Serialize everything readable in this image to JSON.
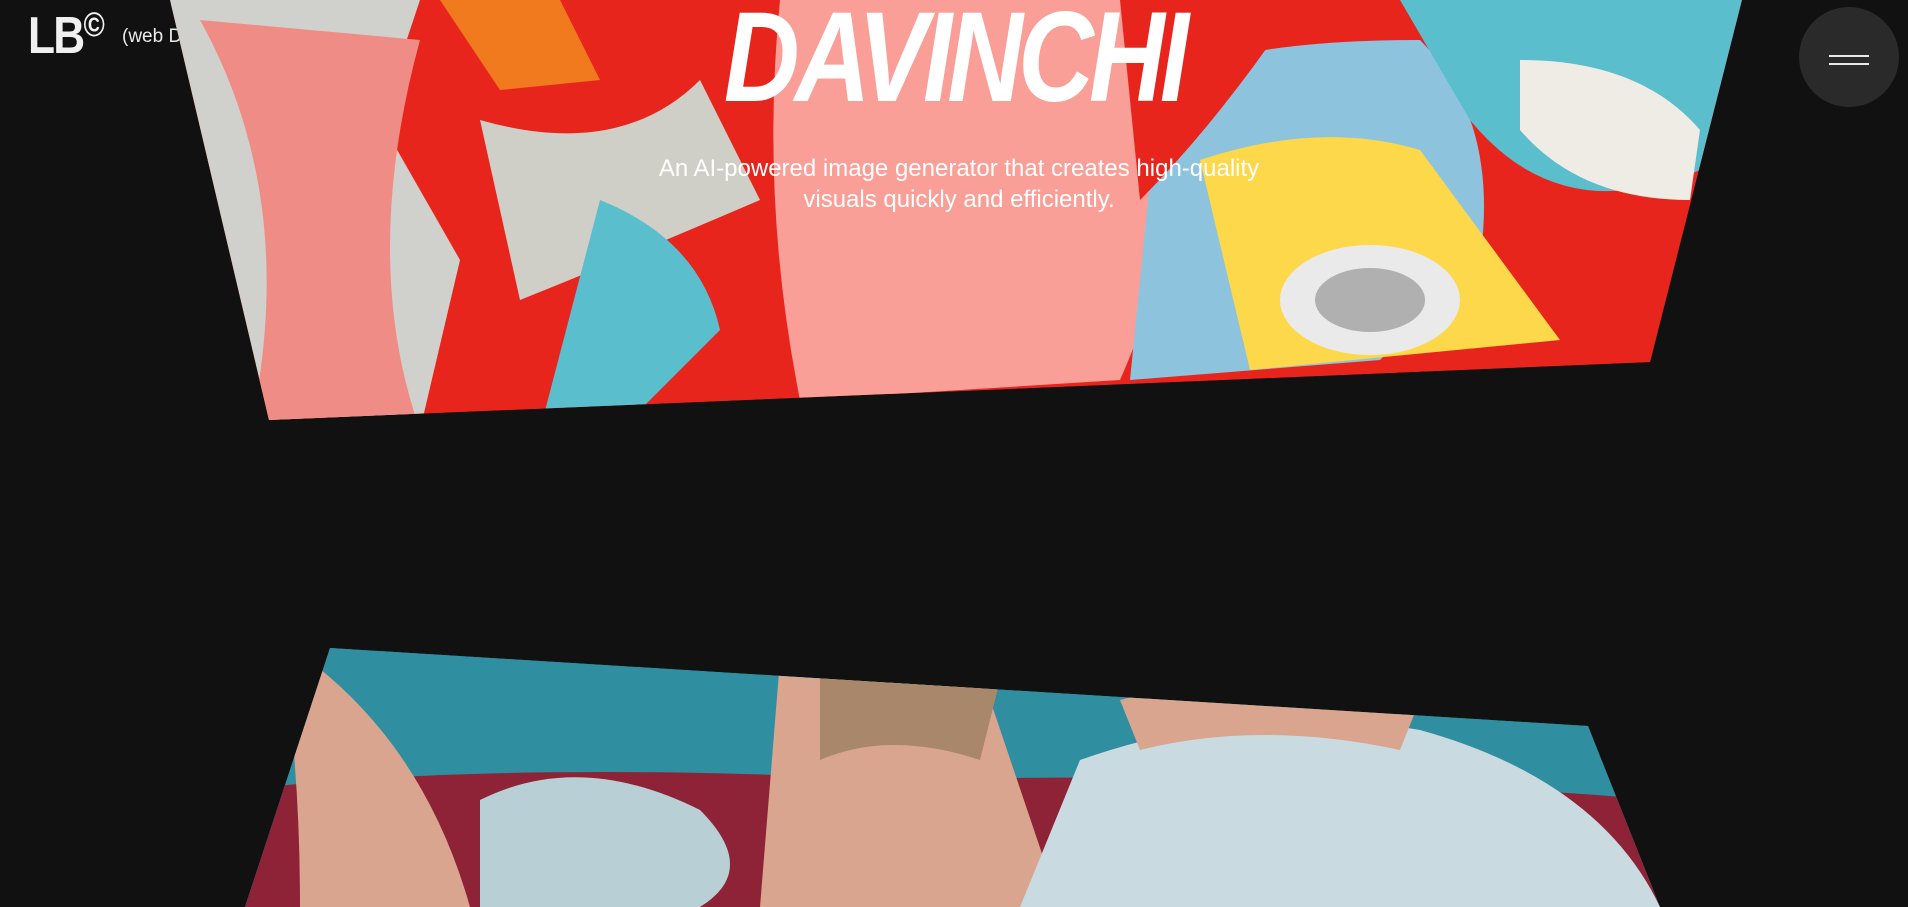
{
  "header": {
    "logo_text": "LB",
    "logo_symbol": "©",
    "role": "(web Developer / Designer)",
    "menu_icon": "hamburger-icon"
  },
  "projects": [
    {
      "title": "DAVINCHI",
      "description_line1": "An AI-powered image generator that creates high-quality",
      "description_line2": "visuals quickly and efficiently.",
      "palette": [
        "#e8251c",
        "#fa9e98",
        "#5bbecd",
        "#fcd84a",
        "#d0d0cc"
      ]
    },
    {
      "palette": [
        "#2f8fa0",
        "#d9a58f",
        "#b9cfd6",
        "#8e2236"
      ]
    }
  ],
  "colors": {
    "background": "#111111",
    "menu_bg": "#2a2a2a"
  }
}
